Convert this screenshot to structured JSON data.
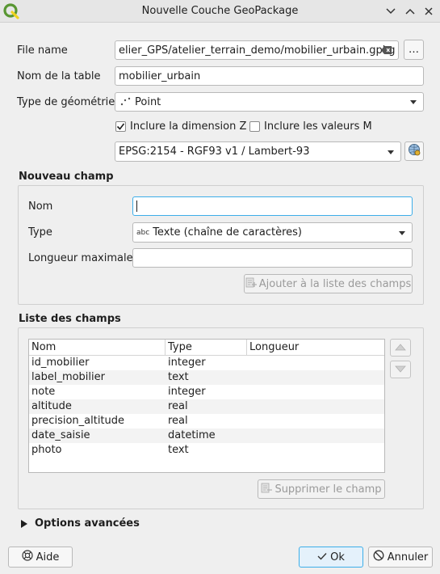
{
  "window": {
    "title": "Nouvelle Couche GeoPackage",
    "buttons": [
      "minimize",
      "maximize",
      "close"
    ]
  },
  "form": {
    "file_name_label": "File name",
    "file_name_value": "elier_GPS/atelier_terrain_demo/mobilier_urbain.gpkg",
    "browse_label": "…",
    "table_name_label": "Nom de la table",
    "table_name_value": "mobilier_urbain",
    "geometry_type_label": "Type de géométrie",
    "geometry_type_value": "Point",
    "include_z_label": "Inclure la dimension Z",
    "include_z_checked": true,
    "include_m_label": "Inclure les valeurs M",
    "include_m_checked": false,
    "crs_value": "EPSG:2154 - RGF93 v1 / Lambert-93"
  },
  "new_field": {
    "section_title": "Nouveau champ",
    "name_label": "Nom",
    "name_value": "",
    "type_label": "Type",
    "type_prefix": "abc",
    "type_value": "Texte (chaîne de caractères)",
    "max_length_label": "Longueur maximale",
    "max_length_value": "",
    "add_button": "Ajouter à la liste des champs"
  },
  "fields_list": {
    "section_title": "Liste des champs",
    "columns": [
      "Nom",
      "Type",
      "Longueur"
    ],
    "rows": [
      {
        "name": "id_mobilier",
        "type": "integer",
        "length": ""
      },
      {
        "name": "label_mobilier",
        "type": "text",
        "length": ""
      },
      {
        "name": "note",
        "type": "integer",
        "length": ""
      },
      {
        "name": "altitude",
        "type": "real",
        "length": ""
      },
      {
        "name": "precision_altitude",
        "type": "real",
        "length": ""
      },
      {
        "name": "date_saisie",
        "type": "datetime",
        "length": ""
      },
      {
        "name": "photo",
        "type": "text",
        "length": ""
      }
    ],
    "delete_button": "Supprimer le champ"
  },
  "advanced": {
    "label": "Options avancées"
  },
  "footer": {
    "help_label": "Aide",
    "ok_label": "Ok",
    "cancel_label": "Annuler"
  },
  "colors": {
    "accent": "#3daee9",
    "qgis_green": "#589632",
    "qgis_yellow": "#f0d31e"
  }
}
